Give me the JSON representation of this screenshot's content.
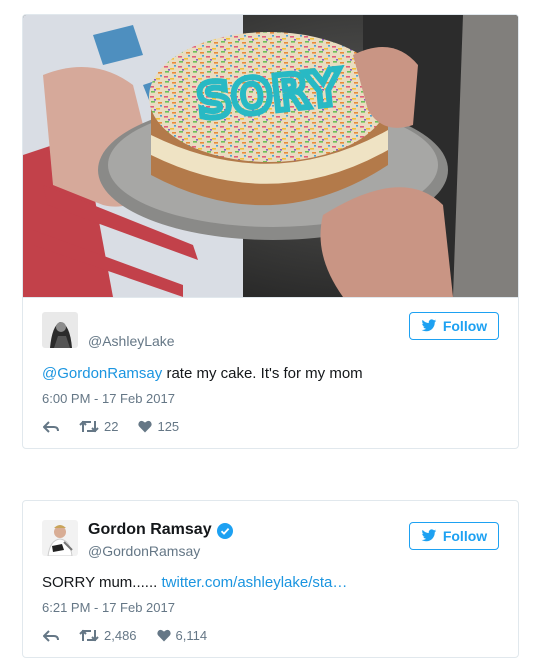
{
  "tweets": [
    {
      "user_handle": "@AshleyLake",
      "follow_label": "Follow",
      "text_mention": "@GordonRamsay",
      "text_body": " rate my cake. It's for my mom",
      "timestamp": "6:00 PM - 17 Feb 2017",
      "retweets": "22",
      "likes": "125",
      "media": {
        "cake_text": "SORY",
        "description": "cake"
      }
    },
    {
      "user_name": "Gordon Ramsay",
      "user_handle": "@GordonRamsay",
      "verified": true,
      "follow_label": "Follow",
      "text_body": "SORRY mum...... ",
      "text_link": "twitter.com/ashleylake/sta…",
      "timestamp": "6:21 PM - 17 Feb 2017",
      "retweets": "2,486",
      "likes": "6,114"
    }
  ],
  "colors": {
    "accent": "#1da1f2",
    "link": "#1b95e0",
    "muted": "#657786",
    "border": "#e1e8ed"
  }
}
